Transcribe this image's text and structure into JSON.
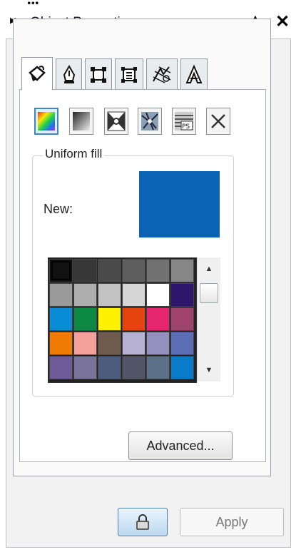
{
  "window": {
    "title": "Object Properties"
  },
  "tabs": [
    {
      "name": "fill",
      "icon": "paint-bucket-icon",
      "active": true
    },
    {
      "name": "outline",
      "icon": "pen-nib-icon"
    },
    {
      "name": "summary",
      "icon": "frame-icon"
    },
    {
      "name": "frame",
      "icon": "text-frame-icon"
    },
    {
      "name": "transparency",
      "icon": "pattern-icon"
    },
    {
      "name": "character",
      "icon": "character-a-icon"
    }
  ],
  "fill_types": [
    {
      "icon": "uniform-fill-icon",
      "active": true
    },
    {
      "icon": "fountain-fill-icon"
    },
    {
      "icon": "vector-pattern-icon"
    },
    {
      "icon": "bitmap-pattern-icon"
    },
    {
      "icon": "postscript-fill-icon"
    },
    {
      "icon": "no-fill-icon"
    }
  ],
  "uniform_fill": {
    "label": "Uniform fill",
    "new_label": "New:",
    "new_color": "#0a63b5"
  },
  "palette_rows": [
    [
      "#111111",
      "#373737",
      "#4b4b4b",
      "#5e5e5e",
      "#727272",
      "#868686"
    ],
    [
      "#9a9a9a",
      "#aeaeae",
      "#c2c2c2",
      "#d6d6d6",
      "#ffffff",
      "#2e146a"
    ],
    [
      "#0a8bd6",
      "#0c8a43",
      "#fef200",
      "#e6440e",
      "#e5266e",
      "#a1436f"
    ],
    [
      "#f07b05",
      "#f4a19c",
      "#6f5b4d",
      "#b7b1d4",
      "#958fbf",
      "#5d6fb4"
    ],
    [
      "#6e5a98",
      "#7a749d",
      "#4b5c7f",
      "#525468",
      "#5b7188",
      "#0a7acb"
    ]
  ],
  "buttons": {
    "advanced": "Advanced...",
    "apply": "Apply",
    "lock_icon": "lock-icon"
  }
}
